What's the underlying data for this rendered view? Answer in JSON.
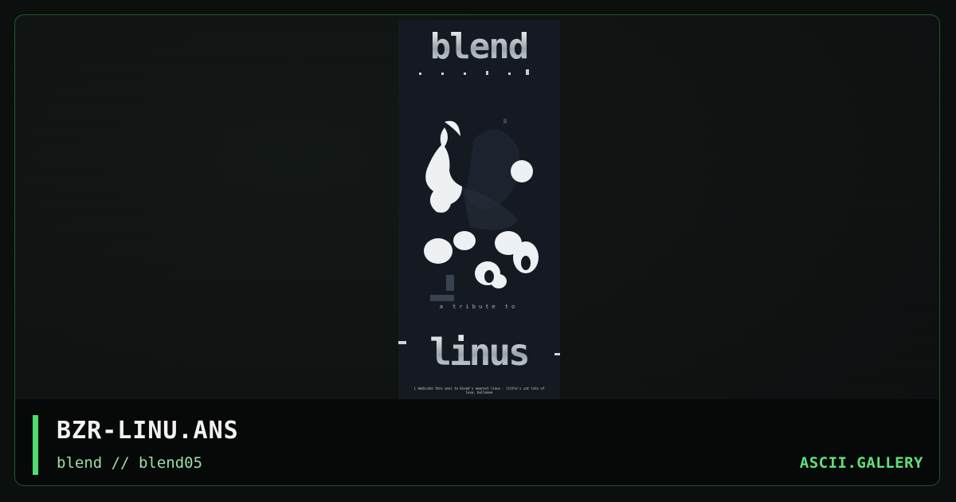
{
  "artwork": {
    "logo_text": "blend",
    "tagline": "a tribute to",
    "name_text": "linus",
    "dedication": "i dedicate this ansi to blend's nearest linus - little's cat lots of love, bulleane"
  },
  "footer": {
    "title": "BZR-LINU.ANS",
    "subtitle": "blend // blend05",
    "brand": "ASCII.GALLERY"
  },
  "colors": {
    "accent": "#4fdc6f",
    "brand": "#5fe07a",
    "subtitle": "#9bdfa8",
    "frame_border": "#1f5a2a"
  }
}
